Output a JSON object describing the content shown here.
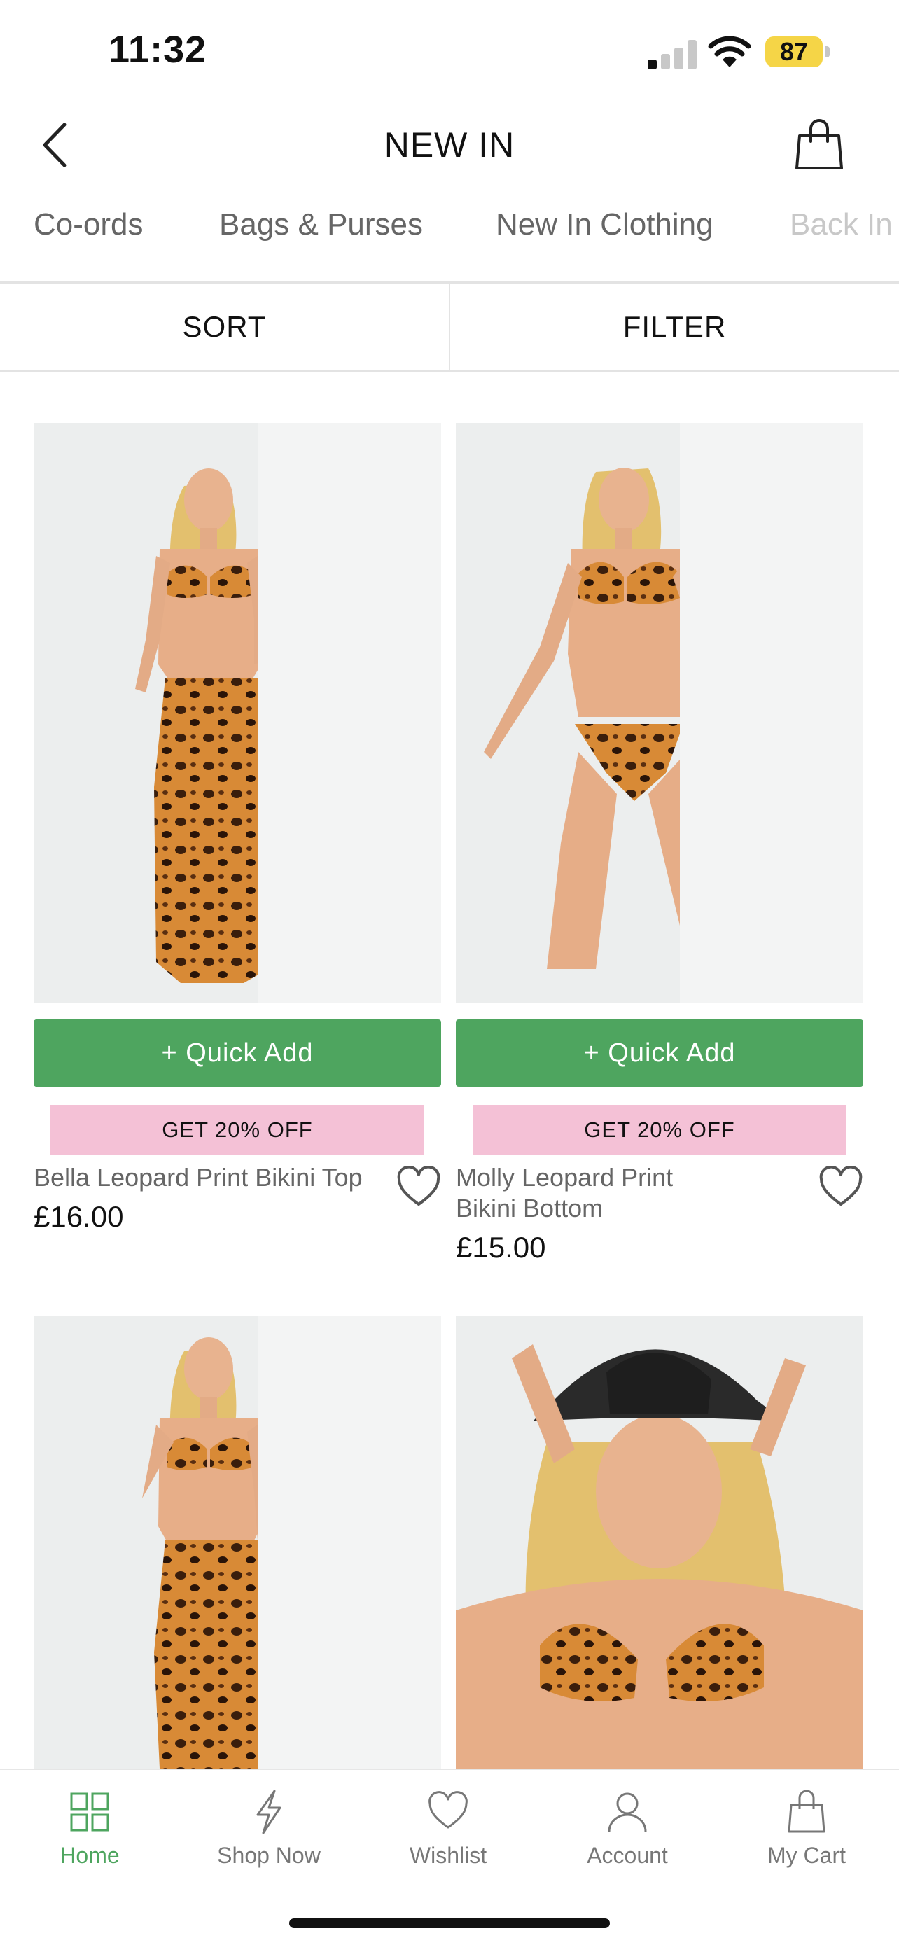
{
  "status_bar": {
    "time": "11:32",
    "battery": "87"
  },
  "header": {
    "title": "NEW IN"
  },
  "categories": [
    "Co-ords",
    "Bags & Purses",
    "New In Clothing",
    "Back In"
  ],
  "sort_label": "SORT",
  "filter_label": "FILTER",
  "products": [
    {
      "name": "Bella Leopard Print Bikini Top",
      "price": "£16.00",
      "quick_add": "+ Quick Add",
      "promo": "GET 20% OFF"
    },
    {
      "name": "Molly Leopard Print Bikini Bottom",
      "price": "£15.00",
      "quick_add": "+ Quick Add",
      "promo": "GET 20% OFF"
    },
    {
      "name": "",
      "price": ""
    },
    {
      "name": "",
      "price": ""
    }
  ],
  "tabbar": {
    "items": [
      {
        "label": "Home",
        "icon": "grid-icon",
        "active": true
      },
      {
        "label": "Shop Now",
        "icon": "lightning-icon",
        "active": false
      },
      {
        "label": "Wishlist",
        "icon": "heart-icon",
        "active": false
      },
      {
        "label": "Account",
        "icon": "user-icon",
        "active": false
      },
      {
        "label": "My Cart",
        "icon": "bag-icon",
        "active": false
      }
    ]
  },
  "colors": {
    "accent_green": "#4ea55f",
    "promo_pink": "#f4c1d6",
    "battery_yellow": "#f5d547"
  }
}
